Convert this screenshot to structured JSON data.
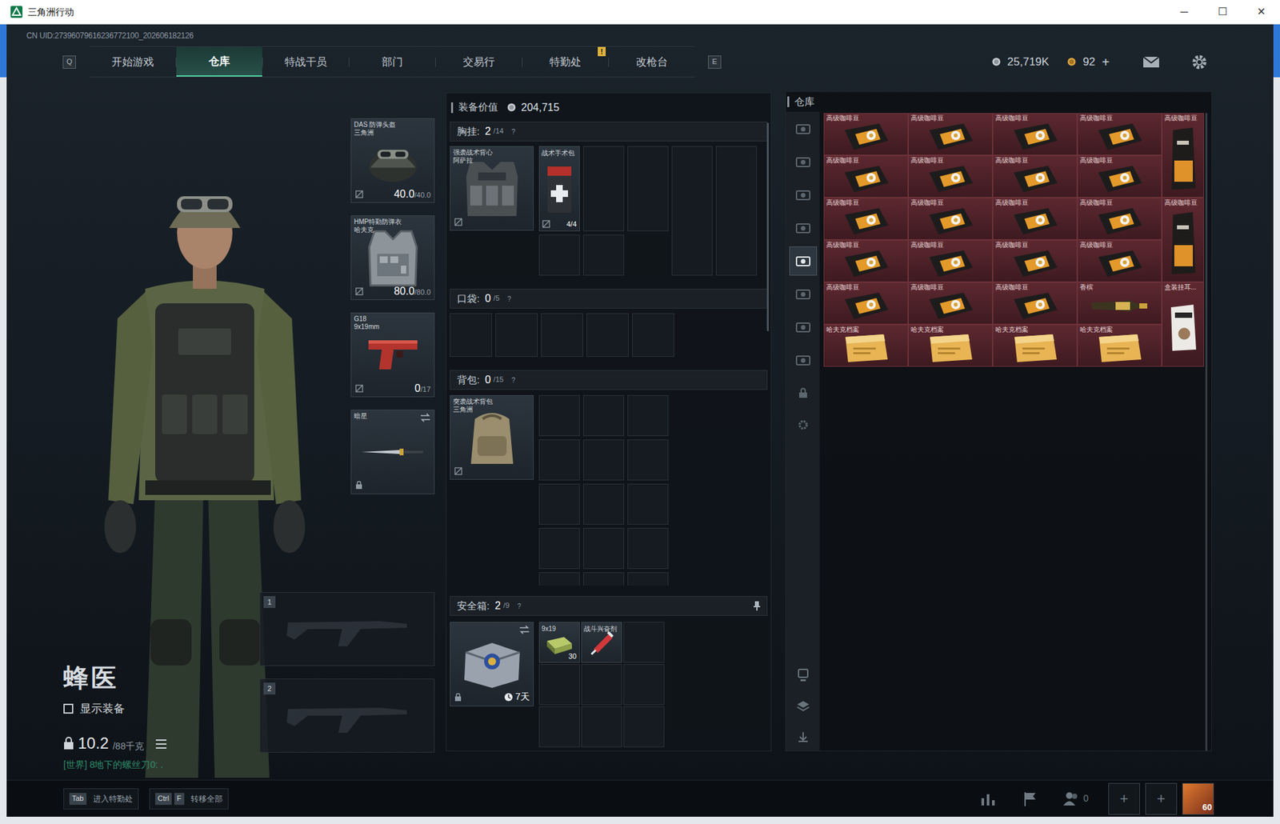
{
  "window": {
    "title": "三角洲行动",
    "controls": [
      "─",
      "☐",
      "✕"
    ]
  },
  "uid": "CN UID:27396079616236772100_202606182126",
  "nav": {
    "left_key": "Q",
    "right_key": "E",
    "alert_text": "!",
    "tabs": [
      {
        "label": "开始游戏",
        "selected": false,
        "alert": false
      },
      {
        "label": "仓库",
        "selected": true,
        "alert": false
      },
      {
        "label": "特战干员",
        "selected": false,
        "alert": false
      },
      {
        "label": "部门",
        "selected": false,
        "alert": false
      },
      {
        "label": "交易行",
        "selected": false,
        "alert": false
      },
      {
        "label": "特勤处",
        "selected": false,
        "alert": true
      },
      {
        "label": "改枪台",
        "selected": false,
        "alert": false
      }
    ]
  },
  "currency": {
    "coins": "25,719K",
    "bonds": "92",
    "add": "+"
  },
  "operator": {
    "name": "蜂医",
    "show_gear": {
      "label": "显示装备",
      "checked": false
    },
    "weight": "10.2",
    "weight_max": "/88千克",
    "chat": "[世界] 8地下的螺丝刀0: ."
  },
  "gear": [
    {
      "kind": "helmet",
      "name": "DAS 防弹头盔",
      "sub": "三角洲",
      "value": "40.0",
      "max": "/40.0"
    },
    {
      "kind": "armor",
      "name": "HMP特勤防弹衣",
      "sub": "哈夫克",
      "value": "80.0",
      "max": "/80.0"
    },
    {
      "kind": "pistol",
      "name": "G18",
      "sub": "9x19mm",
      "value": "0",
      "max": "/17"
    },
    {
      "kind": "melee",
      "name": "暗星"
    }
  ],
  "weapon_slots": [
    "1",
    "2"
  ],
  "loadout": {
    "value_label": "装备价值",
    "value": "204,715",
    "help": "?",
    "chest": {
      "title": "胸挂:",
      "count": "2",
      "cap": "/14",
      "item": {
        "name": "强袭战术背心",
        "sub": "阿萨拉"
      },
      "contents": [
        {
          "name": "战术手术包",
          "count": "4/4"
        }
      ]
    },
    "pocket": {
      "title": "口袋:",
      "count": "0",
      "cap": "/5"
    },
    "backpack": {
      "title": "背包:",
      "count": "0",
      "cap": "/15",
      "item": {
        "name": "突袭战术背包",
        "sub": "三角洲"
      }
    },
    "safe": {
      "title": "安全箱:",
      "count": "2",
      "cap": "/9",
      "timer": "7天",
      "contents": [
        {
          "name": "9x19",
          "count": "30",
          "kind": "ammo"
        },
        {
          "name": "战斗兴奋剂",
          "kind": "stim"
        }
      ]
    }
  },
  "stash": {
    "title": "仓库",
    "tabs": [
      {
        "selected": false
      },
      {
        "selected": false
      },
      {
        "selected": false
      },
      {
        "selected": false
      },
      {
        "selected": true
      },
      {
        "selected": false
      },
      {
        "selected": false
      },
      {
        "selected": false
      }
    ],
    "items": [
      {
        "name": "高级咖啡豆",
        "kind": "pack"
      },
      {
        "name": "高级咖啡豆",
        "kind": "pack"
      },
      {
        "name": "高级咖啡豆",
        "kind": "pack"
      },
      {
        "name": "高级咖啡豆",
        "kind": "pack"
      },
      {
        "name": "高级咖啡豆",
        "kind": "bag"
      },
      {
        "name": "高级咖啡豆",
        "kind": "pack"
      },
      {
        "name": "高级咖啡豆",
        "kind": "pack"
      },
      {
        "name": "高级咖啡豆",
        "kind": "pack"
      },
      {
        "name": "高级咖啡豆",
        "kind": "pack"
      },
      {
        "name": "高级咖啡豆",
        "kind": "pack"
      },
      {
        "name": "高级咖啡豆",
        "kind": "pack"
      },
      {
        "name": "高级咖啡豆",
        "kind": "pack"
      },
      {
        "name": "高级咖啡豆",
        "kind": "pack"
      },
      {
        "name": "高级咖啡豆",
        "kind": "bag"
      },
      {
        "name": "高级咖啡豆",
        "kind": "pack"
      },
      {
        "name": "高级咖啡豆",
        "kind": "pack"
      },
      {
        "name": "高级咖啡豆",
        "kind": "pack"
      },
      {
        "name": "高级咖啡豆",
        "kind": "pack"
      },
      {
        "name": "高级咖啡豆",
        "kind": "pack"
      },
      {
        "name": "高级咖啡豆",
        "kind": "pack"
      },
      {
        "name": "高级咖啡豆",
        "kind": "pack"
      },
      {
        "name": "香槟",
        "kind": "bottle"
      },
      {
        "name": "盒装挂耳...",
        "kind": "box"
      },
      {
        "name": "哈夫克档案",
        "kind": "folder"
      },
      {
        "name": "哈夫克档案",
        "kind": "folder"
      },
      {
        "name": "哈夫克档案",
        "kind": "folder"
      },
      {
        "name": "哈夫克档案",
        "kind": "folder"
      }
    ]
  },
  "bottom": {
    "hints": [
      {
        "keys": [
          "Tab"
        ],
        "label": "进入特勤处"
      },
      {
        "keys": [
          "Ctrl",
          "F"
        ],
        "label": "转移全部"
      }
    ],
    "friends": "0",
    "slots": [
      "+",
      "+"
    ],
    "level": "60"
  }
}
